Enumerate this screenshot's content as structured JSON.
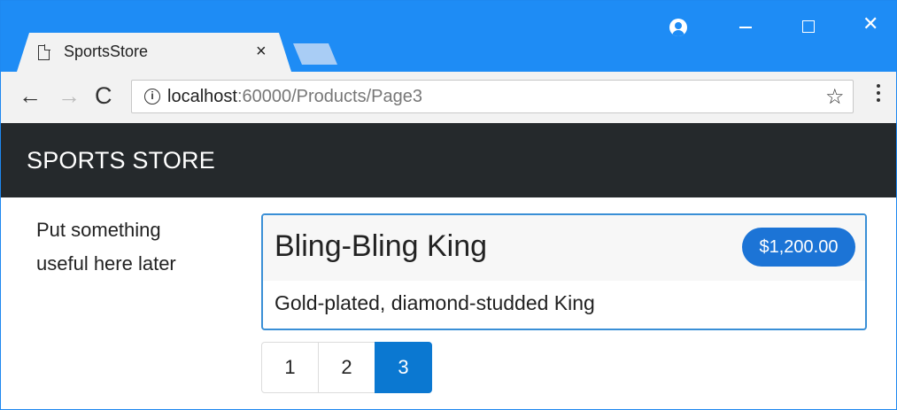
{
  "browser": {
    "tab_title": "SportsStore",
    "tab_close": "×",
    "window_close": "✕",
    "address_host": "localhost",
    "address_path": ":60000/Products/Page3",
    "star": "☆",
    "back": "←",
    "forward": "→",
    "reload": "C",
    "info": "i",
    "accent_color": "#1e8cf5"
  },
  "navbar": {
    "brand": "SPORTS STORE",
    "background": "#25292c"
  },
  "sidebar": {
    "text": "Put something useful here later"
  },
  "product": {
    "name": "Bling-Bling King",
    "price": "$1,200.00",
    "description": "Gold-plated, diamond-studded King"
  },
  "pagination": {
    "pages": [
      "1",
      "2",
      "3"
    ],
    "current": "3"
  }
}
